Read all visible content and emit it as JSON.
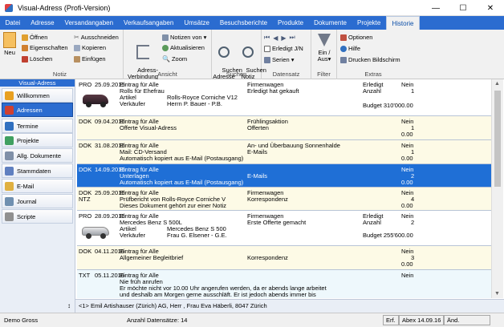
{
  "window": {
    "title": "Visual-Adress (Profi-Version)",
    "minimize": "—",
    "maximize": "☐",
    "close": "✕"
  },
  "menu": [
    "Datei",
    "Adresse",
    "Versandangaben",
    "Verkaufsangaben",
    "Umsätze",
    "Besuchsberichte",
    "Produkte",
    "Dokumente",
    "Projekte",
    "Historie"
  ],
  "menu_active": "Historie",
  "ribbon": {
    "notiz": {
      "title": "Notiz",
      "neu": "Neu",
      "oeffnen": "Öffnen",
      "eigenschaften": "Eigenschaften",
      "loeschen": "Löschen",
      "ausschneiden": "Ausschneiden",
      "kopieren": "Kopieren",
      "einfuegen": "Einfügen"
    },
    "ansicht": {
      "title": "Ansicht",
      "adress_verbindung": "Adress-\nVerbindung",
      "notizen_von": "Notizen von",
      "aktualisieren": "Aktualisieren",
      "zoom": "Zoom"
    },
    "suchen": {
      "title": "Suchen",
      "suchen_adresse": "Suchen\nAdresse",
      "suchen_notiz": "Suchen\nNotiz"
    },
    "datensatz": {
      "title": "Datensatz",
      "erledigt": "Erledigt J/N",
      "serien": "Serien"
    },
    "filter": {
      "title": "Filter",
      "ein_aus": "Ein / Aus"
    },
    "extras": {
      "title": "Extras",
      "optionen": "Optionen",
      "hilfe": "Hilfe",
      "drucken": "Drucken Bildschirm"
    }
  },
  "sidebar": {
    "header": "Visual-Adress",
    "items": [
      {
        "label": "Willkommen",
        "icon": "home-icon",
        "color": "#e8a020"
      },
      {
        "label": "Adressen",
        "icon": "address-book-icon",
        "color": "#d04030"
      },
      {
        "label": "Termine",
        "icon": "calendar-icon",
        "color": "#3070c0"
      },
      {
        "label": "Projekte",
        "icon": "project-icon",
        "color": "#40a060"
      },
      {
        "label": "Allg. Dokumente",
        "icon": "document-icon",
        "color": "#8090a8"
      },
      {
        "label": "Stammdaten",
        "icon": "database-icon",
        "color": "#6080c0"
      },
      {
        "label": "E-Mail",
        "icon": "mail-icon",
        "color": "#e0b040"
      },
      {
        "label": "Journal",
        "icon": "journal-icon",
        "color": "#7090b0"
      },
      {
        "label": "Scripte",
        "icon": "script-icon",
        "color": "#909090"
      }
    ],
    "active": 1
  },
  "records": [
    {
      "type": "PRO",
      "date": "25.09.2015",
      "l1": "Eintrag für Alle",
      "l2": "Rolls für Ehefrau",
      "l3a": "Artikel",
      "l3b": "Rolls-Royce Corniche V12",
      "l4a": "Verkäufer",
      "l4b": "Herrn P. Bauer - P.B.",
      "m1": "Firmenwagen",
      "m2": "Erledigt hat gekauft",
      "r1a": "Erledigt",
      "r1b": "Nein",
      "r2a": "Anzahl",
      "r2b": "1",
      "r4": "Budget 310'000.00",
      "image": "car-image"
    },
    {
      "type": "DOK",
      "date": "09.04.2016",
      "l1": "Eintrag für Alle",
      "l2": "Offerte Visual-Adress",
      "m1": "Frühlingsaktion",
      "m2": "Offerten",
      "r1b": "Nein",
      "r2b": "1",
      "r3b": "0.00"
    },
    {
      "type": "DOK",
      "date": "31.08.2016",
      "l1": "Eintrag für Alle",
      "l2": "Mail: CD-Versand",
      "l3": "Automatisch kopiert aus E-Mail (Postausgang)",
      "m1": "An- und Überbauung Sonnenhalde",
      "m2": "E-Mails",
      "r1b": "Nein",
      "r2b": "1",
      "r3b": "0.00"
    },
    {
      "type": "DOK",
      "date": "14.09.2016",
      "l1": "Eintrag für Alle",
      "l2": "Unterlagen",
      "l3": "Automatisch kopiert aus E-Mail (Postausgang)",
      "m2": "E-Mails",
      "r1b": "Nein",
      "r2b": "2",
      "r3b": "0.00"
    },
    {
      "type": "DOK",
      "type2": "NTZ",
      "date": "25.09.2016",
      "l1": "Eintrag für Alle",
      "l2": "Prüfbericht von Rolls-Royce Corniche V",
      "l3": "Dieses Dokument gehört zur einer Notiz",
      "m1": "Firmenwagen",
      "m2": "Korrespondenz",
      "r1b": "Nein",
      "r2b": "4",
      "r3b": "0.00"
    },
    {
      "type": "PRO",
      "date": "28.09.2016",
      "l1": "Eintrag für Alle",
      "l2": "Mercedes Benz S 500L",
      "l3a": "Artikel",
      "l3b": "Mercedes Benz S 500",
      "l4a": "Verkäufer",
      "l4b": "Frau G. Elsener - G.E.",
      "m1": "Firmenwagen",
      "m2": "Erste Offerte gemacht",
      "r1a": "Erledigt",
      "r1b": "Nein",
      "r2a": "Anzahl",
      "r2b": "2",
      "r4": "Budget 255'600.00",
      "image": "car-image"
    },
    {
      "type": "DOK",
      "date": "04.11.2016",
      "l1": "Eintrag für Alle",
      "l2": "Allgemeiner Begleitbrief",
      "m2": "Korrespondenz",
      "r1b": "Nein",
      "r2b": "3",
      "r3b": "0.00"
    },
    {
      "type": "TXT",
      "date": "05.11.2016",
      "l1": "Eintrag für Alle",
      "l2": "Nie früh anrufen",
      "l3": "Er möchte nicht vor 10.00 Uhr angerufen werden, da er abends lange arbeitet",
      "l4": "und deshalb am Morgen gerne ausschläft. Er ist jedoch abends immer bis",
      "r1b": "Nein"
    }
  ],
  "address_bar": {
    "arrow": "↕",
    "text": "<1> Emil Artishauser (Zürich) AG, Herr , Frau Eva Häberli, 8047 Zürich"
  },
  "status": {
    "user": "Demo Gross",
    "count": "Anzahl Datensätze: 14",
    "erf": "Erf.",
    "abex": "Abex 14.09.16",
    "aend": "Änd."
  },
  "colors": {
    "menubar": "#2b6cd0",
    "selection": "#1f6fd6",
    "cream": "#fdfae6"
  }
}
